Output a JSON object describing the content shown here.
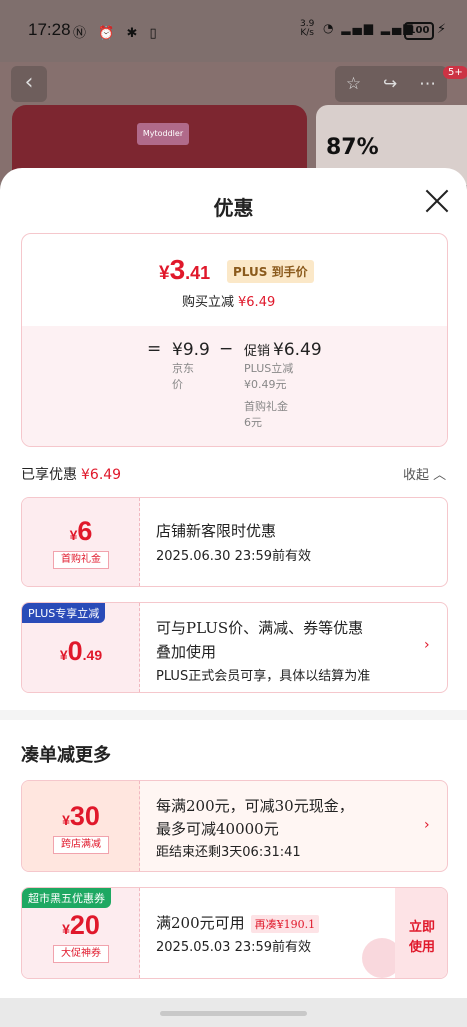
{
  "status_bar": {
    "time": "17:28",
    "net_speed_value": "3.9",
    "net_speed_unit": "K/s",
    "battery": "100"
  },
  "background": {
    "cart_badge": "5+",
    "brand": "Mytoddler",
    "percent": "87%"
  },
  "sheet": {
    "title": "优惠",
    "summary": {
      "final_currency": "¥",
      "final_int": "3",
      "final_dec": ".41",
      "plus_tag": "PLUS 到手价",
      "buy_minus_label": "购买立减",
      "buy_minus_value": "¥6.49",
      "equals": "=",
      "jd_price": "¥9.9",
      "jd_label": "京东价",
      "minus": "−",
      "promo_label": "促销",
      "promo_value": "¥6.49",
      "plus_off_label": "PLUS立减",
      "plus_off_value": "¥0.49元",
      "gift_label": "首购礼金",
      "gift_value": "6元"
    },
    "enjoyed_label": "已享优惠",
    "enjoyed_value": "¥6.49",
    "collapse_label": "收起 ︿",
    "coupons": [
      {
        "currency": "¥",
        "amount": "6",
        "label": "首购礼金",
        "title": "店铺新客限时优惠",
        "subtitle": "2025.06.30 23:59前有效"
      },
      {
        "tag": "PLUS专享立减",
        "currency": "¥",
        "amount": "0",
        "amount_dec": ".49",
        "title_line1": "可与PLUS价、满减、券等优惠",
        "title_line2": "叠加使用",
        "subtitle": "PLUS正式会员可享，具体以结算为准",
        "chevron": "›"
      }
    ],
    "more_title": "凑单减更多",
    "more_coupons": [
      {
        "currency": "¥",
        "amount": "30",
        "label": "跨店满减",
        "title_line1": "每满200元，可减30元现金，",
        "title_line2": "最多可减40000元",
        "countdown": "距结束还剩3天06:31:41",
        "chevron": "›"
      },
      {
        "tag": "超市黑五优惠券",
        "currency": "¥",
        "amount": "20",
        "label": "大促神券",
        "title": "满200元可用",
        "gap": "再凑¥190.1",
        "subtitle": "2025.05.03 23:59前有效",
        "action_line1": "立即",
        "action_line2": "使用"
      }
    ]
  },
  "colors": {
    "accent": "#e0182b",
    "plus_tag_bg": "#fbe8c8",
    "plus_badge": "#2a4bb8",
    "market_badge": "#1ea862"
  }
}
